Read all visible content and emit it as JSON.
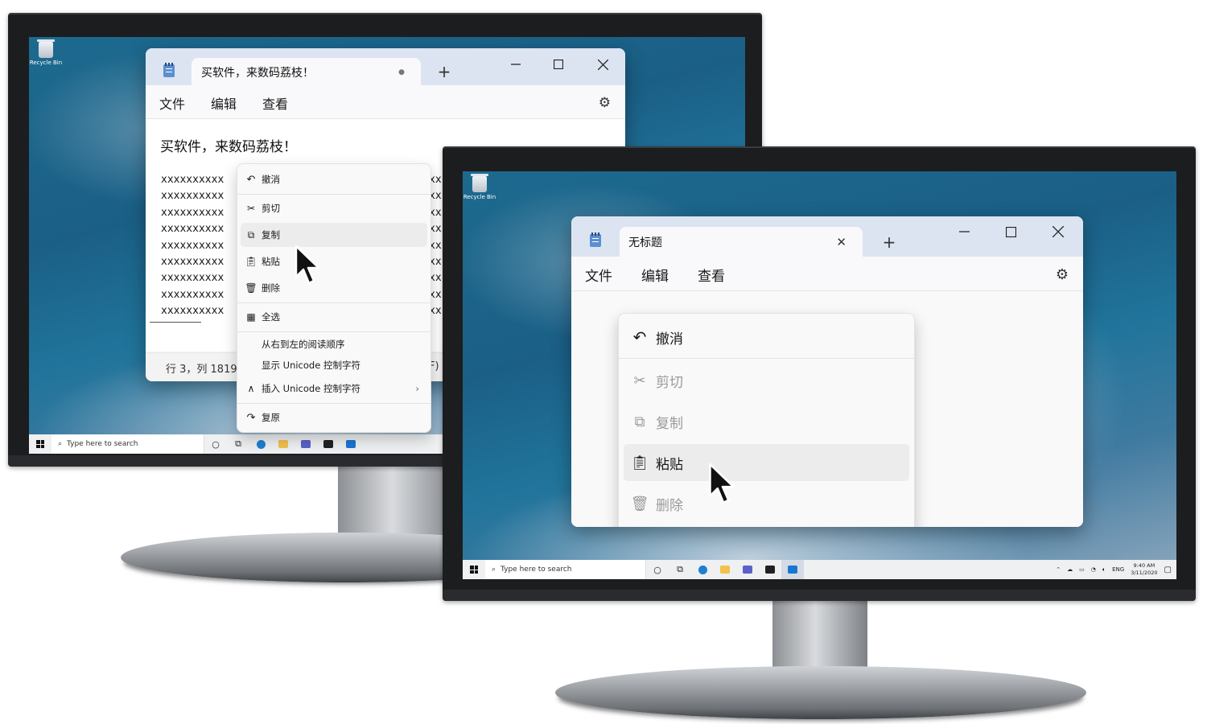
{
  "desktop": {
    "recycle_bin_label": "Recycle Bin",
    "taskbar": {
      "search_placeholder": "Type here to search",
      "tray_lang": "ENG",
      "time": "9:40 AM",
      "date": "3/11/2020"
    }
  },
  "left_monitor": {
    "notepad": {
      "tab_title": "买软件，来数码荔枝！",
      "tab_unsaved_dot": "●",
      "new_tab": "+",
      "menu": [
        "文件",
        "编辑",
        "查看"
      ],
      "content_heading": "买软件，来数码荔枝！",
      "content_lines_left": [
        "xxxxxxxxxx",
        "xxxxxxxxxx",
        "xxxxxxxxxx",
        "xxxxxxxxxx",
        "xxxxxxxxxx",
        "xxxxxxxxxx",
        "xxxxxxxxxx",
        "xxxxxxxxxx",
        "xxxxxxxxxx"
      ],
      "content_lines_right": [
        "xx",
        "xx",
        "xx",
        "xx",
        "xx",
        "xx",
        "xx",
        "xx",
        "xx"
      ],
      "status_left": "行 3，列 1819",
      "status_right": "F)"
    },
    "context_menu": {
      "items": [
        {
          "icon": "undo-icon",
          "label": "撤消"
        },
        {
          "icon": "cut-icon",
          "label": "剪切"
        },
        {
          "icon": "copy-icon",
          "label": "复制",
          "hover": true
        },
        {
          "icon": "paste-icon",
          "label": "粘贴"
        },
        {
          "icon": "delete-icon",
          "label": "删除"
        },
        {
          "icon": "select-all-icon",
          "label": "全选"
        },
        {
          "label": "从右到左的阅读顺序"
        },
        {
          "label": "显示 Unicode 控制字符"
        },
        {
          "icon": "insert-icon",
          "label": "插入 Unicode 控制字符",
          "submenu": "›"
        },
        {
          "icon": "redo-icon",
          "label": "复原"
        }
      ]
    }
  },
  "right_monitor": {
    "notepad": {
      "tab_title": "无标题",
      "tab_close": "✕",
      "new_tab": "+",
      "menu": [
        "文件",
        "编辑",
        "查看"
      ]
    },
    "context_menu": {
      "items": [
        {
          "icon": "undo-icon",
          "label": "撤消"
        },
        {
          "icon": "cut-icon",
          "label": "剪切",
          "disabled": true
        },
        {
          "icon": "copy-icon",
          "label": "复制",
          "disabled": true
        },
        {
          "icon": "paste-icon",
          "label": "粘贴",
          "hover": true
        },
        {
          "icon": "delete-icon",
          "label": "删除",
          "disabled": true
        }
      ]
    }
  }
}
